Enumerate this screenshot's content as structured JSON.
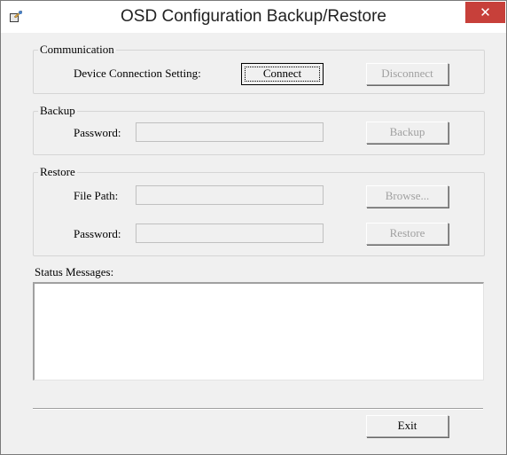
{
  "window": {
    "title": "OSD Configuration Backup/Restore",
    "close_symbol": "✕",
    "app_icon": "config-app-icon",
    "close_color": "#c7403a"
  },
  "communication": {
    "legend": "Communication",
    "connection_label": "Device Connection Setting:",
    "connect_label": "Connect",
    "disconnect_label": "Disconnect"
  },
  "backup": {
    "legend": "Backup",
    "password_label": "Password:",
    "password_value": "",
    "button_label": "Backup"
  },
  "restore": {
    "legend": "Restore",
    "file_path_label": "File Path:",
    "file_path_value": "",
    "browse_label": "Browse...",
    "password_label": "Password:",
    "password_value": "",
    "button_label": "Restore"
  },
  "status": {
    "label": "Status Messages:",
    "messages": ""
  },
  "footer": {
    "exit_label": "Exit"
  }
}
